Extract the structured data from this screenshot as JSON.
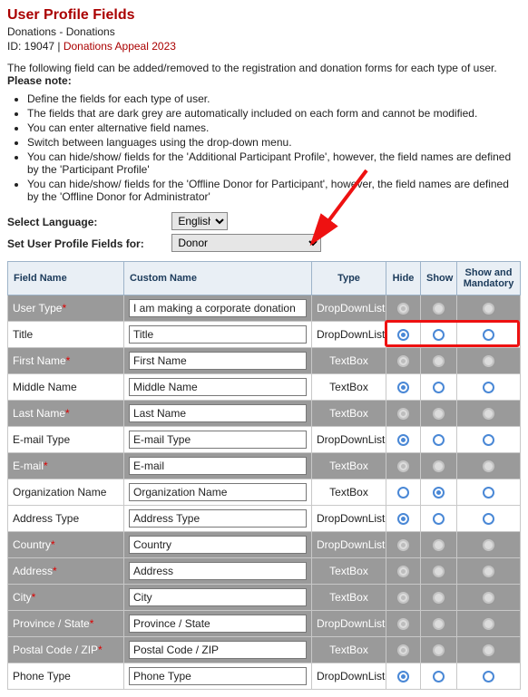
{
  "header": {
    "title": "User Profile Fields",
    "subtitle": "Donations - Donations",
    "id_label": "ID: 19047 | ",
    "appeal_link": "Donations Appeal 2023"
  },
  "intro": {
    "text_prefix": "The following field can be added/removed to the registration and donation forms for each type of user. ",
    "note_label": "Please note:"
  },
  "bullets": [
    "Define the fields for each type of user.",
    "The fields that are dark grey are automatically included on each form and cannot be modified.",
    "You can enter alternative field names.",
    "Switch between languages using the drop-down menu.",
    "You can hide/show/ fields for the 'Additional Participant Profile', however, the field names are defined by the 'Participant Profile'",
    "You can hide/show/ fields for the 'Offline Donor for Participant', however, the field names are defined by the 'Offline Donor for Administrator'"
  ],
  "language": {
    "label": "Select Language:",
    "selected": "English"
  },
  "fields_for": {
    "label": "Set User Profile Fields for:",
    "selected": "Donor"
  },
  "table": {
    "headers": {
      "field_name": "Field Name",
      "custom_name": "Custom Name",
      "type": "Type",
      "hide": "Hide",
      "show": "Show",
      "show_mand": "Show and Mandatory"
    },
    "rows": [
      {
        "field": "User Type",
        "required": true,
        "custom": "I am making a corporate donation",
        "type": "DropDownList",
        "locked": true,
        "state": "hide",
        "highlight": false
      },
      {
        "field": "Title",
        "required": false,
        "custom": "Title",
        "type": "DropDownList",
        "locked": false,
        "state": "hide",
        "highlight": true
      },
      {
        "field": "First Name",
        "required": true,
        "custom": "First Name",
        "type": "TextBox",
        "locked": true,
        "state": "hide",
        "highlight": false
      },
      {
        "field": "Middle Name",
        "required": false,
        "custom": "Middle Name",
        "type": "TextBox",
        "locked": false,
        "state": "hide",
        "highlight": false
      },
      {
        "field": "Last Name",
        "required": true,
        "custom": "Last Name",
        "type": "TextBox",
        "locked": true,
        "state": "hide",
        "highlight": false
      },
      {
        "field": "E-mail Type",
        "required": false,
        "custom": "E-mail Type",
        "type": "DropDownList",
        "locked": false,
        "state": "hide",
        "highlight": false
      },
      {
        "field": "E-mail",
        "required": true,
        "custom": "E-mail",
        "type": "TextBox",
        "locked": true,
        "state": "hide",
        "highlight": false
      },
      {
        "field": "Organization Name",
        "required": false,
        "custom": "Organization Name",
        "type": "TextBox",
        "locked": false,
        "state": "show",
        "highlight": false
      },
      {
        "field": "Address Type",
        "required": false,
        "custom": "Address Type",
        "type": "DropDownList",
        "locked": false,
        "state": "hide",
        "highlight": false
      },
      {
        "field": "Country",
        "required": true,
        "custom": "Country",
        "type": "DropDownList",
        "locked": true,
        "state": "hide",
        "highlight": false
      },
      {
        "field": "Address",
        "required": true,
        "custom": "Address",
        "type": "TextBox",
        "locked": true,
        "state": "hide",
        "highlight": false
      },
      {
        "field": "City",
        "required": true,
        "custom": "City",
        "type": "TextBox",
        "locked": true,
        "state": "hide",
        "highlight": false
      },
      {
        "field": "Province / State",
        "required": true,
        "custom": "Province / State",
        "type": "DropDownList",
        "locked": true,
        "state": "hide",
        "highlight": false
      },
      {
        "field": "Postal Code / ZIP",
        "required": true,
        "custom": "Postal Code / ZIP",
        "type": "TextBox",
        "locked": true,
        "state": "hide",
        "highlight": false
      },
      {
        "field": "Phone Type",
        "required": false,
        "custom": "Phone Type",
        "type": "DropDownList",
        "locked": false,
        "state": "hide",
        "highlight": false
      }
    ]
  }
}
